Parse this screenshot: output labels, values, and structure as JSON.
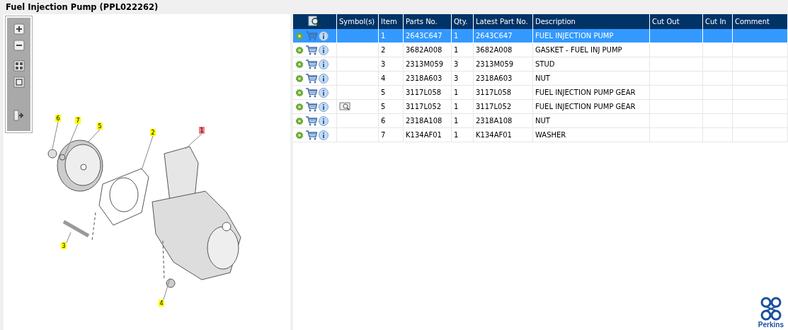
{
  "window": {
    "title": "Fuel Injection Pump (PPL022262)"
  },
  "diagram": {
    "callouts": [
      {
        "label": "6",
        "selected": false
      },
      {
        "label": "7",
        "selected": false
      },
      {
        "label": "5",
        "selected": false
      },
      {
        "label": "2",
        "selected": false
      },
      {
        "label": "1",
        "selected": true
      },
      {
        "label": "3",
        "selected": false
      },
      {
        "label": "4",
        "selected": false
      }
    ]
  },
  "table": {
    "columns": [
      "Symbol(s)",
      "Item",
      "Parts No.",
      "Qty.",
      "Latest Part No.",
      "Description",
      "Cut Out",
      "Cut In",
      "Comment"
    ],
    "rows": [
      {
        "selected": true,
        "has_symbol": false,
        "cells": [
          "",
          "1",
          "2643C647",
          "1",
          "2643C647",
          "FUEL INJECTION PUMP"
        ]
      },
      {
        "selected": false,
        "has_symbol": false,
        "cells": [
          "",
          "2",
          "3682A008",
          "1",
          "3682A008",
          "GASKET - FUEL INJ PUMP"
        ]
      },
      {
        "selected": false,
        "has_symbol": false,
        "cells": [
          "",
          "3",
          "2313M059",
          "3",
          "2313M059",
          "STUD"
        ]
      },
      {
        "selected": false,
        "has_symbol": false,
        "cells": [
          "",
          "4",
          "2318A603",
          "3",
          "2318A603",
          "NUT"
        ]
      },
      {
        "selected": false,
        "has_symbol": false,
        "cells": [
          "",
          "5",
          "3117L058",
          "1",
          "3117L058",
          "FUEL INJECTION PUMP GEAR"
        ]
      },
      {
        "selected": false,
        "has_symbol": true,
        "cells": [
          "",
          "5",
          "3117L052",
          "1",
          "3117L052",
          "FUEL INJECTION PUMP GEAR"
        ]
      },
      {
        "selected": false,
        "has_symbol": false,
        "cells": [
          "",
          "6",
          "2318A108",
          "1",
          "2318A108",
          "NUT"
        ]
      },
      {
        "selected": false,
        "has_symbol": false,
        "cells": [
          "",
          "7",
          "K134AF01",
          "1",
          "K134AF01",
          "WASHER"
        ]
      }
    ]
  },
  "logo": {
    "text": "Perkins"
  }
}
